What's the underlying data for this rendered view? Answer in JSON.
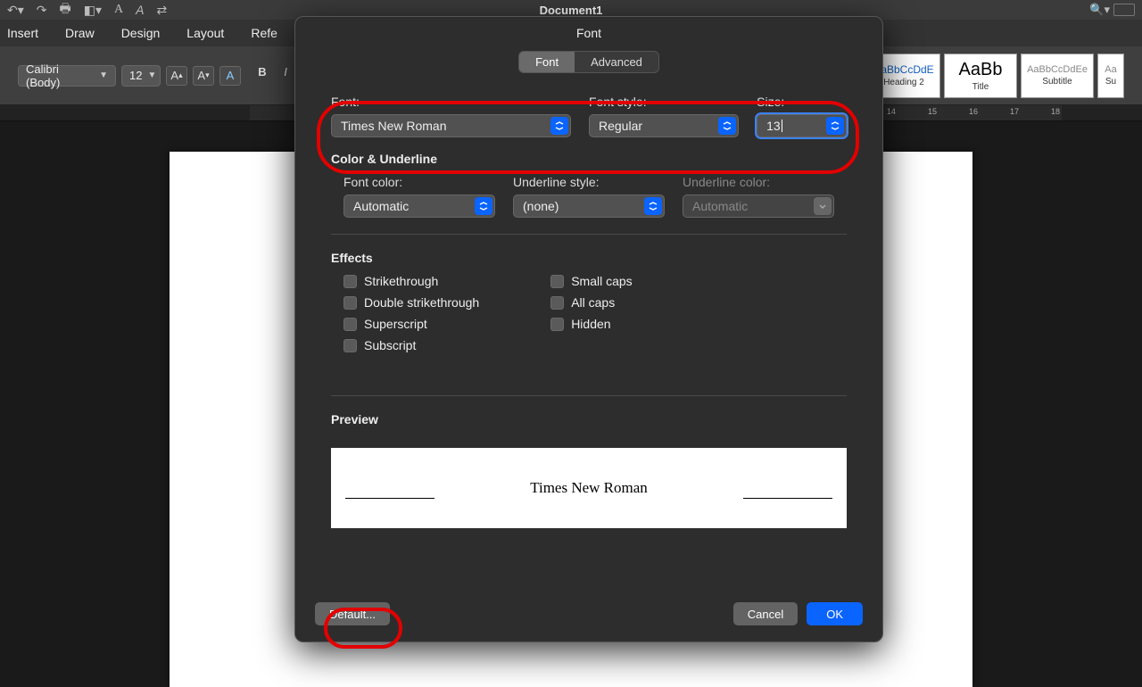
{
  "app": {
    "title": "Document1"
  },
  "topbar_icons": [
    "undo",
    "redo",
    "print",
    "toggle",
    "text-a",
    "text-case",
    "overflow"
  ],
  "ribbon_tabs": [
    "Insert",
    "Draw",
    "Design",
    "Layout",
    "Refe"
  ],
  "ribbon": {
    "font_name": "Calibri (Body)",
    "font_size": "12"
  },
  "style_tiles": [
    {
      "sample": "AaBbCcDdE",
      "label": "Heading 2",
      "cls": ""
    },
    {
      "sample": "AaBb",
      "label": "Title",
      "cls": "big"
    },
    {
      "sample": "AaBbCcDdEe",
      "label": "Subtitle",
      "cls": "gray"
    },
    {
      "sample": "Aa",
      "label": "Su",
      "cls": "gray"
    }
  ],
  "ruler_right": [
    "14",
    "15",
    "16",
    "17",
    "18"
  ],
  "dialog": {
    "title": "Font",
    "tabs": {
      "font": "Font",
      "advanced": "Advanced"
    },
    "font": {
      "labels": {
        "font": "Font:",
        "style": "Font style:",
        "size": "Size:"
      },
      "font_value": "Times New Roman",
      "style_value": "Regular",
      "size_value": "13"
    },
    "color_section": {
      "heading": "Color & Underline",
      "font_color_label": "Font color:",
      "font_color_value": "Automatic",
      "underline_style_label": "Underline style:",
      "underline_style_value": "(none)",
      "underline_color_label": "Underline color:",
      "underline_color_value": "Automatic"
    },
    "effects": {
      "heading": "Effects",
      "left": [
        "Strikethrough",
        "Double strikethrough",
        "Superscript",
        "Subscript"
      ],
      "right": [
        "Small caps",
        "All caps",
        "Hidden"
      ]
    },
    "preview": {
      "heading": "Preview",
      "text": "Times New Roman"
    },
    "buttons": {
      "default": "Default...",
      "cancel": "Cancel",
      "ok": "OK"
    }
  }
}
